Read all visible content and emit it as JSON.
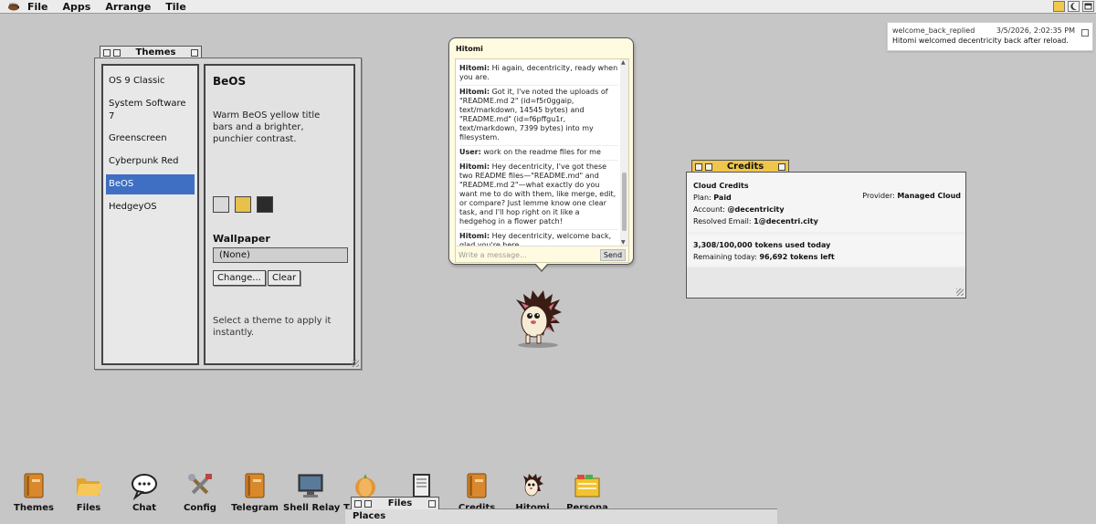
{
  "menubar": {
    "logo_icon": "hedgehog-icon",
    "menus": [
      "File",
      "Apps",
      "Arrange",
      "Tile"
    ],
    "tray_icons": [
      "folder-icon",
      "moon-icon",
      "window-icon"
    ]
  },
  "notification": {
    "event": "welcome_back_replied",
    "timestamp": "3/5/2026, 2:02:35 PM",
    "message": "Hitomi welcomed decentricity back after reload."
  },
  "themes_window": {
    "title": "Themes",
    "themes": [
      {
        "label": "OS 9 Classic"
      },
      {
        "label": "System Software 7"
      },
      {
        "label": "Greenscreen"
      },
      {
        "label": "Cyberpunk Red"
      },
      {
        "label": "BeOS"
      },
      {
        "label": "HedgeyOS"
      }
    ],
    "selected_index": 4,
    "selected_name": "BeOS",
    "description": "Warm BeOS yellow title bars and a brighter, punchier contrast.",
    "swatches": [
      "#d9d9d9",
      "#e8c14a",
      "#2b2b2b"
    ],
    "wallpaper_label": "Wallpaper",
    "wallpaper_value": "(None)",
    "change_button": "Change...",
    "clear_button": "Clear",
    "hint": "Select a theme to apply it instantly."
  },
  "chat": {
    "title": "Hitomi",
    "messages": [
      {
        "sender": "Hitomi:",
        "text": "Hi again, decentricity, ready when you are."
      },
      {
        "sender": "Hitomi:",
        "text": "Got it, I've noted the uploads of \"README.md 2\" (id=f5r0ggaip, text/markdown, 14545 bytes) and \"README.md\" (id=f6pffgu1r, text/markdown, 7399 bytes) into my filesystem."
      },
      {
        "sender": "User:",
        "text": "work on the readme files for me"
      },
      {
        "sender": "Hitomi:",
        "text": "Hey decentricity, I've got these two README files—\"README.md\" and \"README.md 2\"—what exactly do you want me to do with them, like merge, edit, or compare? Just lemme know one clear task, and I'll hop right on it like a hedgehog in a flower patch!"
      },
      {
        "sender": "Hitomi:",
        "text": "Hey decentricity, welcome back, glad you're here."
      }
    ],
    "input_placeholder": "Write a message...",
    "send_label": "Send"
  },
  "credits_window": {
    "title": "Credits",
    "heading": "Cloud Credits",
    "plan_label": "Plan:",
    "plan_value": "Paid",
    "provider_label": "Provider:",
    "provider_value": "Managed Cloud",
    "account_label": "Account:",
    "account_value": "@decentricity",
    "email_label": "Resolved Email:",
    "email_value": "1@decentri.city",
    "usage_text": "3,308/100,000 tokens used today",
    "remaining_label": "Remaining today:",
    "remaining_value": "96,692 tokens left"
  },
  "dock": {
    "items": [
      {
        "label": "Themes",
        "icon": "book-icon"
      },
      {
        "label": "Files",
        "icon": "folder-open-icon"
      },
      {
        "label": "Chat",
        "icon": "speech-bubble-icon"
      },
      {
        "label": "Config",
        "icon": "tools-icon"
      },
      {
        "label": "Telegram",
        "icon": "book-icon"
      },
      {
        "label": "Shell Relay",
        "icon": "monitor-icon"
      },
      {
        "label": "T",
        "icon": "onion-icon"
      },
      {
        "label": "",
        "icon": "notebook-icon"
      },
      {
        "label": "Credits",
        "icon": "book-icon"
      },
      {
        "label": "Hitomi",
        "icon": "hedgehog-icon"
      },
      {
        "label": "Persona",
        "icon": "card-file-icon"
      }
    ]
  },
  "files_window": {
    "title": "Files",
    "section": "Places"
  }
}
